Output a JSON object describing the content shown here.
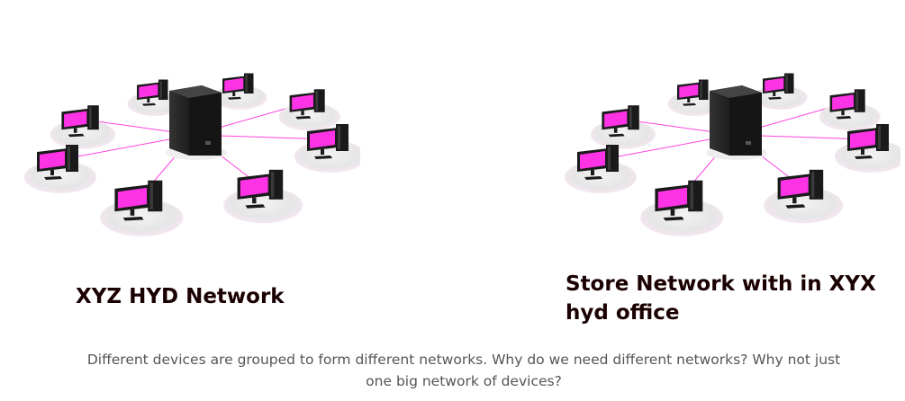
{
  "networks": [
    {
      "title": "XYZ HYD Network"
    },
    {
      "title": "Store Network with in XYX hyd office"
    }
  ],
  "caption": "Different devices are grouped to form different networks. Why do we need different networks? Why not just one big network of devices?",
  "colors": {
    "screen": "#ff33e6",
    "link": "#ff44dd",
    "device": "#1a1a1a",
    "title": "#1a0000",
    "caption": "#555555"
  },
  "icons": {
    "server": "server-tower-icon",
    "client": "desktop-computer-icon"
  }
}
